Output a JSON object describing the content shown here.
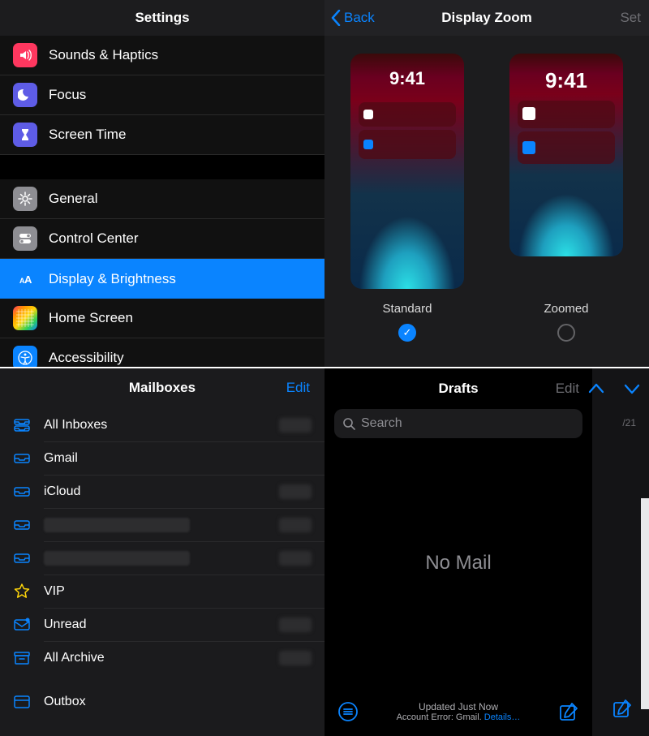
{
  "settings": {
    "title": "Settings",
    "items": [
      {
        "label": "Sounds & Haptics",
        "iconClass": "ic-red",
        "iconName": "speaker-icon"
      },
      {
        "label": "Focus",
        "iconClass": "ic-purple",
        "iconName": "moon-icon"
      },
      {
        "label": "Screen Time",
        "iconClass": "ic-purple2",
        "iconName": "hourglass-icon"
      }
    ],
    "group2": [
      {
        "label": "General",
        "iconClass": "ic-gray",
        "iconName": "gear-icon"
      },
      {
        "label": "Control Center",
        "iconClass": "ic-gray2",
        "iconName": "toggles-icon"
      },
      {
        "label": "Display & Brightness",
        "iconClass": "ic-blue",
        "iconName": "text-size-icon",
        "selected": true
      },
      {
        "label": "Home Screen",
        "iconClass": "ic-multi",
        "iconName": "grid-icon"
      },
      {
        "label": "Accessibility",
        "iconClass": "ic-access",
        "iconName": "accessibility-icon"
      }
    ]
  },
  "zoom": {
    "back": "Back",
    "title": "Display Zoom",
    "set": "Set",
    "clock": "9:41",
    "options": [
      {
        "label": "Standard",
        "selected": true
      },
      {
        "label": "Zoomed",
        "selected": false
      }
    ]
  },
  "mailboxes": {
    "title": "Mailboxes",
    "edit": "Edit",
    "items": [
      {
        "label": "All Inboxes",
        "icon": "tray-stack-icon",
        "badge": true
      },
      {
        "label": "Gmail",
        "icon": "tray-icon",
        "badge": false
      },
      {
        "label": "iCloud",
        "icon": "tray-icon",
        "badge": true
      },
      {
        "label": "[redacted]",
        "icon": "tray-icon",
        "redact": true,
        "badge": true
      },
      {
        "label": "[redacted]",
        "icon": "tray-icon",
        "redact": true,
        "badge": true
      },
      {
        "label": "VIP",
        "icon": "star-icon",
        "star": true,
        "badge": false
      },
      {
        "label": "Unread",
        "icon": "unread-icon",
        "badge": true
      },
      {
        "label": "All Archive",
        "icon": "archive-icon",
        "badge": true
      },
      {
        "label": "Outbox",
        "icon": "outbox-icon",
        "badge": false
      }
    ]
  },
  "drafts": {
    "title": "Drafts",
    "edit": "Edit",
    "search_placeholder": "Search",
    "empty": "No Mail",
    "status_line": "Updated Just Now",
    "error_prefix": "Account Error: Gmail. ",
    "error_link": "Details…",
    "side_date": "/21"
  }
}
